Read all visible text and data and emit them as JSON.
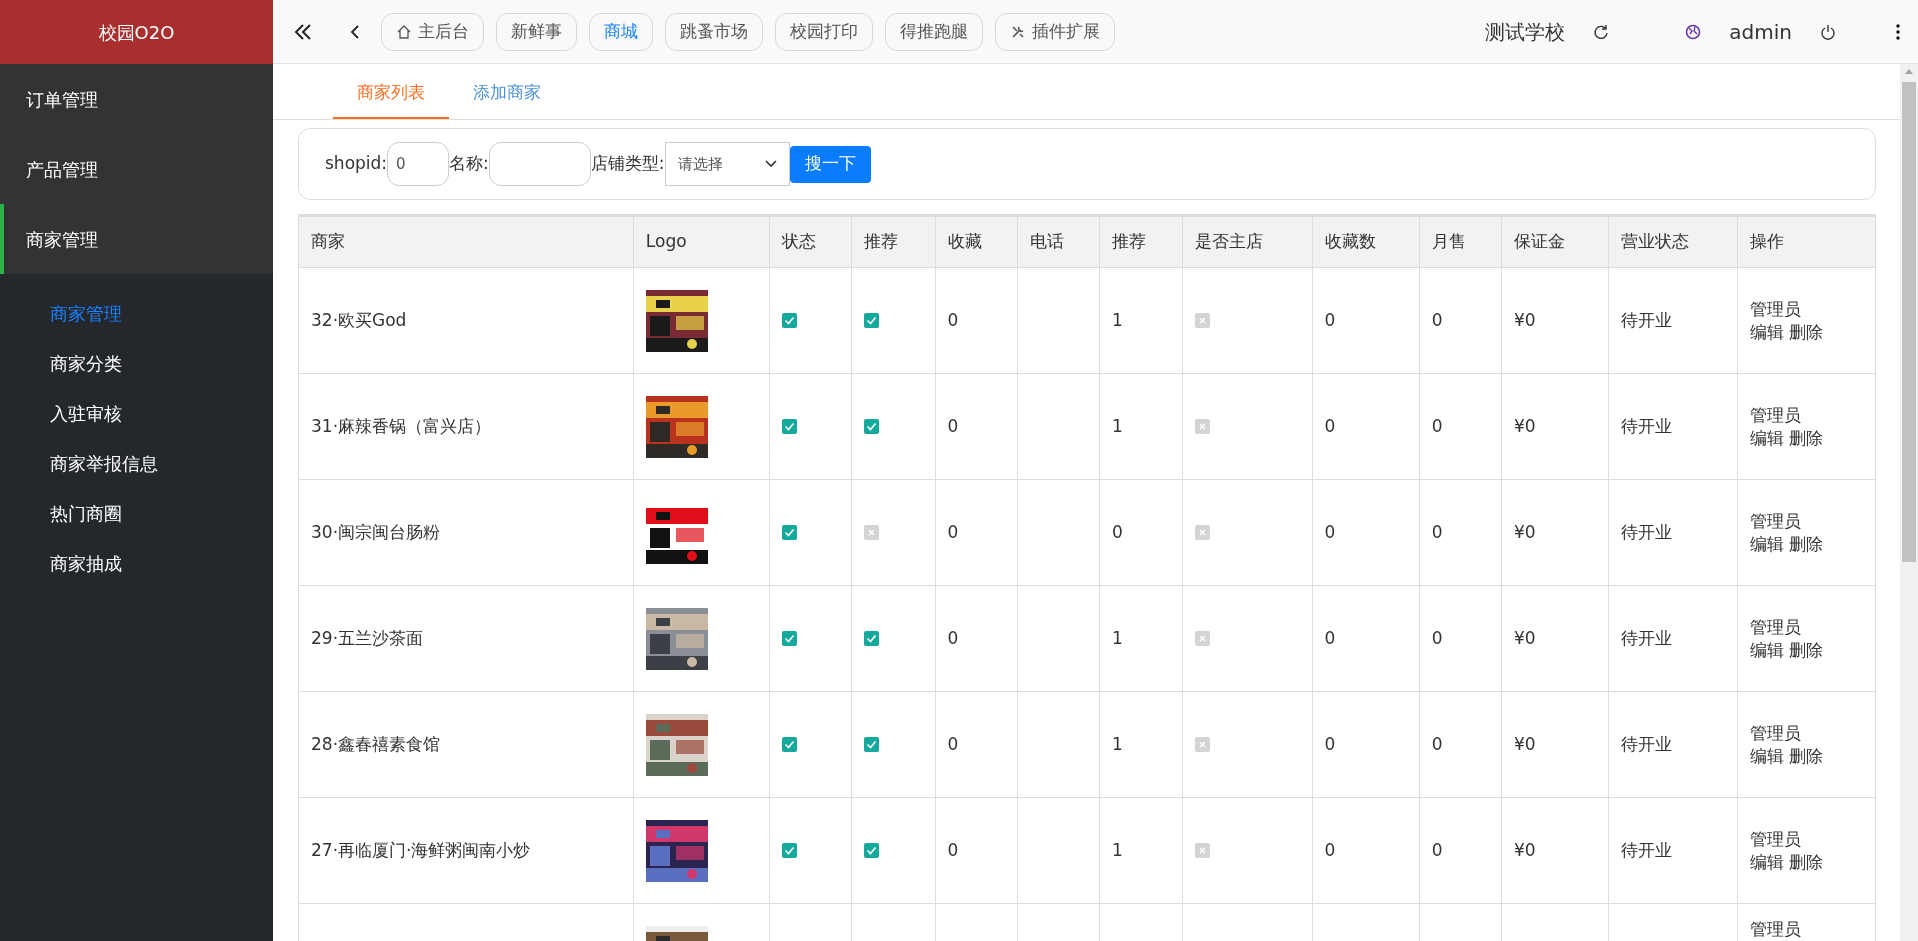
{
  "sidebar": {
    "logo": "校园O2O",
    "items": [
      {
        "label": "订单管理",
        "selected": false
      },
      {
        "label": "产品管理",
        "selected": false
      },
      {
        "label": "商家管理",
        "selected": true,
        "expanded": true,
        "children": [
          {
            "label": "商家管理",
            "selected": true
          },
          {
            "label": "商家分类",
            "selected": false
          },
          {
            "label": "入驻审核",
            "selected": false
          },
          {
            "label": "商家举报信息",
            "selected": false
          },
          {
            "label": "热门商圈",
            "selected": false
          },
          {
            "label": "商家抽成",
            "selected": false
          }
        ]
      }
    ]
  },
  "topbar": {
    "tabs": [
      {
        "label": "主后台",
        "kind": "home",
        "selected": false
      },
      {
        "label": "新鲜事",
        "kind": "plain",
        "selected": false
      },
      {
        "label": "商城",
        "kind": "plain",
        "selected": true
      },
      {
        "label": "跳蚤市场",
        "kind": "plain",
        "selected": false
      },
      {
        "label": "校园打印",
        "kind": "plain",
        "selected": false
      },
      {
        "label": "得推跑腿",
        "kind": "plain",
        "selected": false
      },
      {
        "label": "插件扩展",
        "kind": "tools",
        "selected": false
      }
    ],
    "school": "测试学校",
    "user": "admin"
  },
  "page_tabs": [
    {
      "label": "商家列表",
      "selected": true
    },
    {
      "label": "添加商家",
      "selected": false
    }
  ],
  "search": {
    "shopid_label": "shopid:",
    "shopid_value": "0",
    "name_label": "名称:",
    "type_label": "店铺类型:",
    "type_value": "请选择",
    "button": "搜一下"
  },
  "table": {
    "columns": [
      "商家",
      "Logo",
      "状态",
      "推荐",
      "收藏",
      "电话",
      "推荐",
      "是否主店",
      "收藏数",
      "月售",
      "保证金",
      "营业状态",
      "操作"
    ],
    "rows": [
      {
        "name": "32·欧买God",
        "status": true,
        "recommended": true,
        "favorites": "0",
        "rank": "1",
        "main_store": false,
        "fav_count": "0",
        "monthly": "0",
        "deposit": "¥0",
        "business": "待开业",
        "actions": [
          "管理员",
          "编辑",
          "删除"
        ]
      },
      {
        "name": "31·麻辣香锅（富兴店）",
        "status": true,
        "recommended": true,
        "favorites": "0",
        "rank": "1",
        "main_store": false,
        "fav_count": "0",
        "monthly": "0",
        "deposit": "¥0",
        "business": "待开业",
        "actions": [
          "管理员",
          "编辑",
          "删除"
        ]
      },
      {
        "name": "30·闽宗闽台肠粉",
        "status": true,
        "recommended": false,
        "favorites": "0",
        "rank": "0",
        "main_store": false,
        "fav_count": "0",
        "monthly": "0",
        "deposit": "¥0",
        "business": "待开业",
        "actions": [
          "管理员",
          "编辑",
          "删除"
        ]
      },
      {
        "name": "29·五兰沙茶面",
        "status": true,
        "recommended": true,
        "favorites": "0",
        "rank": "1",
        "main_store": false,
        "fav_count": "0",
        "monthly": "0",
        "deposit": "¥0",
        "business": "待开业",
        "actions": [
          "管理员",
          "编辑",
          "删除"
        ]
      },
      {
        "name": "28·鑫春禧素食馆",
        "status": true,
        "recommended": true,
        "favorites": "0",
        "rank": "1",
        "main_store": false,
        "fav_count": "0",
        "monthly": "0",
        "deposit": "¥0",
        "business": "待开业",
        "actions": [
          "管理员",
          "编辑",
          "删除"
        ]
      },
      {
        "name": "27·再临厦门·海鲜粥闽南小炒",
        "status": true,
        "recommended": true,
        "favorites": "0",
        "rank": "1",
        "main_store": false,
        "fav_count": "0",
        "monthly": "0",
        "deposit": "¥0",
        "business": "待开业",
        "actions": [
          "管理员",
          "编辑",
          "删除"
        ]
      },
      {
        "kind": "cut_off",
        "actions": [
          "管理员"
        ]
      }
    ]
  }
}
